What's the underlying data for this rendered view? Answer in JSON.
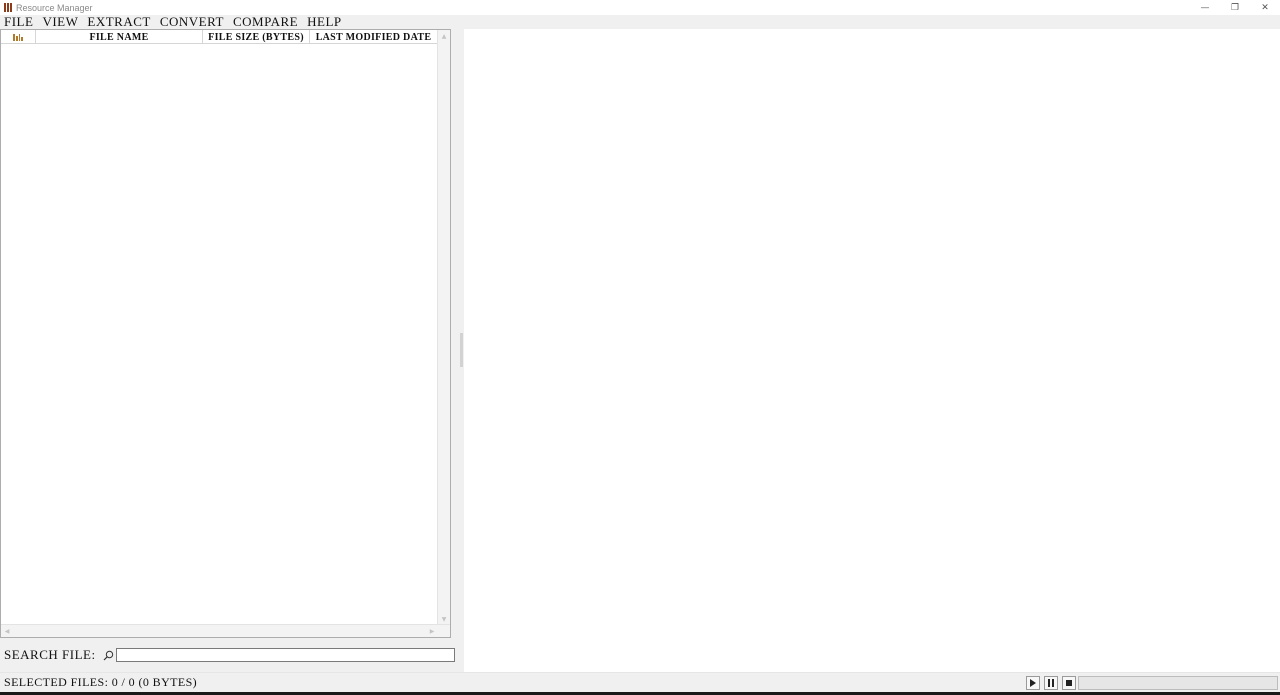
{
  "window": {
    "title": "Resource Manager",
    "controls": {
      "minimize": "—",
      "restore": "❐",
      "close": "✕"
    }
  },
  "menu": {
    "items": [
      "File",
      "View",
      "Extract",
      "Convert",
      "Compare",
      "Help"
    ]
  },
  "file_table": {
    "columns": [
      "File Name",
      "File Size (bytes)",
      "Last Modified date"
    ],
    "rows": []
  },
  "search": {
    "label": "Search File:",
    "value": "",
    "placeholder": ""
  },
  "status": {
    "selected_files": "Selected files: 0 / 0 (0 bytes)",
    "progress_percent": 0
  },
  "icons": {
    "app": "bookshelf-icon",
    "column": "file-type-icon",
    "search": "magnifier-icon",
    "play": "play-icon",
    "pause": "pause-icon",
    "stop": "stop-icon"
  },
  "colors": {
    "app_icon": "#8b3a1a",
    "column_icon": "#b07a2a",
    "progress_fill": "#06b025"
  }
}
